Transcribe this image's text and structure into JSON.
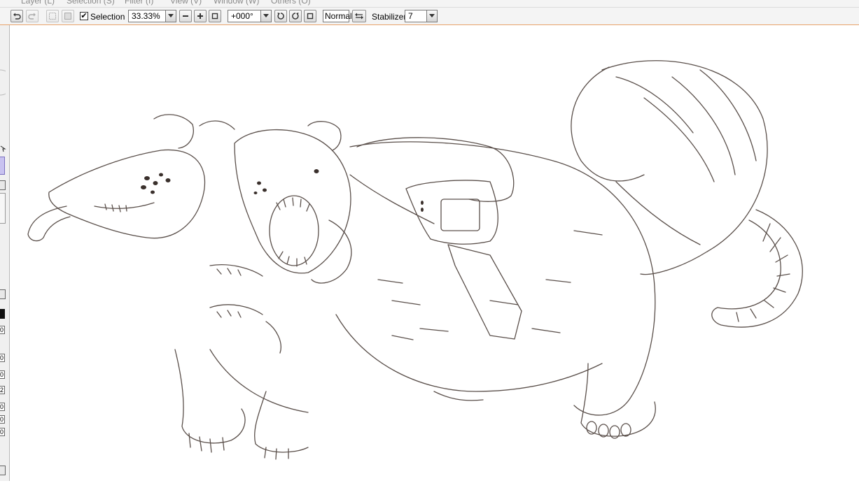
{
  "menu": {
    "items": [
      "Layer (L)",
      "Selection (S)",
      "Filter (I)",
      "View (V)",
      "Window (W)",
      "Others (O)"
    ]
  },
  "toolbar": {
    "selection_label": "Selection",
    "selection_checked": true,
    "zoom_value": "33.33%",
    "rotation_value": "+000°",
    "mode_value": "Normal",
    "stabilizer_label": "Stabilizer",
    "stabilizer_value": "7"
  },
  "left_panel": {
    "box_glyphs": [
      "0",
      "0",
      "0",
      "2",
      "0",
      "0",
      "0"
    ]
  },
  "canvas": {
    "subject": "pencil-sketch-mutant-rat",
    "line_color": "#5a4f4a"
  },
  "colors": {
    "accent_border": "#e8a36a",
    "toolbar_bg": "#f4f4f4",
    "selected_swatch": "#c8c2f0"
  }
}
